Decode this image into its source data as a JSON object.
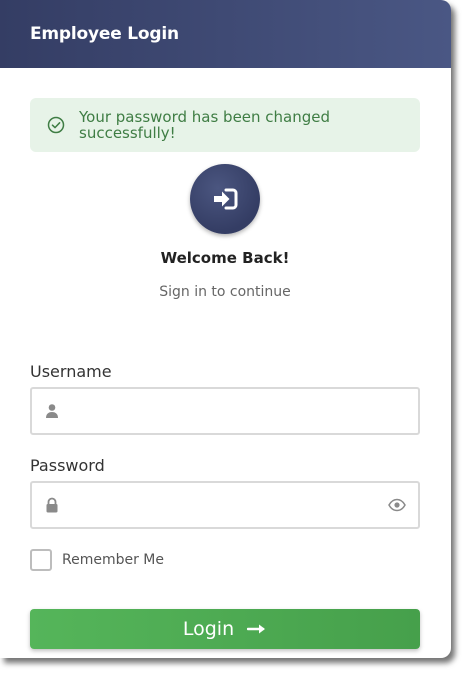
{
  "header": {
    "title": "Employee Login"
  },
  "alert": {
    "message": "Your password has been changed successfully!",
    "icon": "check-circle-icon",
    "color": "#3f7d44",
    "background": "#e7f3e8"
  },
  "hero": {
    "icon": "sign-in-icon",
    "title": "Welcome Back!",
    "subtitle": "Sign in to continue"
  },
  "form": {
    "username": {
      "label": "Username",
      "value": "",
      "placeholder": "",
      "icon": "user-icon"
    },
    "password": {
      "label": "Password",
      "value": "",
      "placeholder": "",
      "icon": "lock-icon",
      "toggle_icon": "eye-icon"
    },
    "remember": {
      "label": "Remember Me",
      "checked": false
    },
    "submit": {
      "label": "Login",
      "icon": "arrow-right-icon"
    }
  },
  "colors": {
    "header_start": "#343d64",
    "header_end": "#4a5784",
    "button": "#4caf50"
  }
}
